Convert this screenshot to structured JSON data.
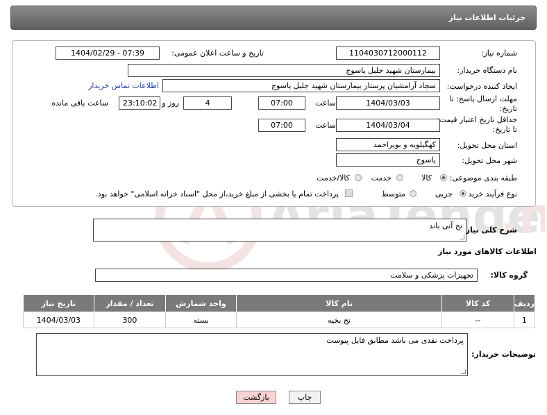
{
  "header": {
    "title": "جزئیات اطلاعات نیاز"
  },
  "form": {
    "need_number": {
      "label": "شماره نیاز:",
      "value": "1104030712000112"
    },
    "announce_datetime": {
      "label": "تاریخ و ساعت اعلان عمومی:",
      "value": "1404/02/29 - 07:39"
    },
    "buyer_org": {
      "label": "نام دستگاه خریدار:",
      "value": "بیمارستان شهید جلیل یاسوج"
    },
    "creator": {
      "label": "ایجاد کننده درخواست:",
      "value": "سجاد آرامشیان پرستار بیمارستان شهید جلیل یاسوج",
      "contact_link": "اطلاعات تماس خریدار"
    },
    "reply_deadline": {
      "label_line1": "مهلت ارسال پاسخ: تا",
      "label_line2": "تاریخ:",
      "date": "1404/03/03",
      "time_label": "ساعت",
      "time": "07:00",
      "days": "4",
      "days_label": "روز و",
      "remaining": "23:10:02",
      "remaining_label": "ساعت باقی مانده"
    },
    "price_validity": {
      "label_line1": "حداقل تاریخ اعتبار قیمت:",
      "label_line2": "تا تاریخ:",
      "date": "1404/03/04",
      "time_label": "ساعت",
      "time": "07:00"
    },
    "delivery_province": {
      "label": "استان محل تحویل:",
      "value": "کهگیلویه و بویراحمد"
    },
    "delivery_city": {
      "label": "شهر محل تحویل:",
      "value": "یاسوج"
    },
    "category": {
      "label": "طبقه بندی موضوعی:",
      "options": [
        "کالا",
        "خدمت",
        "کالا/خدمت"
      ],
      "selected": "کالا"
    },
    "purchase_process": {
      "label": "نوع فرآیند خرید :",
      "options": [
        "جزیی",
        "متوسط"
      ],
      "selected": "جزیی",
      "treasury_note": "پرداخت تمام یا بخشی از مبلغ خرید،از محل \"اسناد خزانه اسلامی\" خواهد بود."
    }
  },
  "general_desc": {
    "label": "شرح کلی نیاز:",
    "value": "نخ آتی باند"
  },
  "goods_info": {
    "title": "اطلاعات کالاهای مورد نیاز"
  },
  "goods_group": {
    "label": "گروه کالا:",
    "value": "تجهیزات پزشکی و سلامت"
  },
  "table": {
    "headers": [
      "ردیف",
      "کد کالا",
      "نام کالا",
      "واحد شمارش",
      "تعداد / مقدار",
      "تاریخ نیاز"
    ],
    "rows": [
      [
        "1",
        "--",
        "نخ بخیه",
        "بسته",
        "300",
        "1404/03/03"
      ]
    ]
  },
  "buyer_notes": {
    "label": "توضیحات خریدار:",
    "value": "پرداخت نقدی می باشد مطابق فایل پیوست"
  },
  "buttons": {
    "print": "چاپ",
    "back": "بازگشت"
  },
  "colors": {
    "header": "#6f6f6f",
    "link": "#1d3fa8",
    "back_button_bg": "#f7d3d3"
  }
}
